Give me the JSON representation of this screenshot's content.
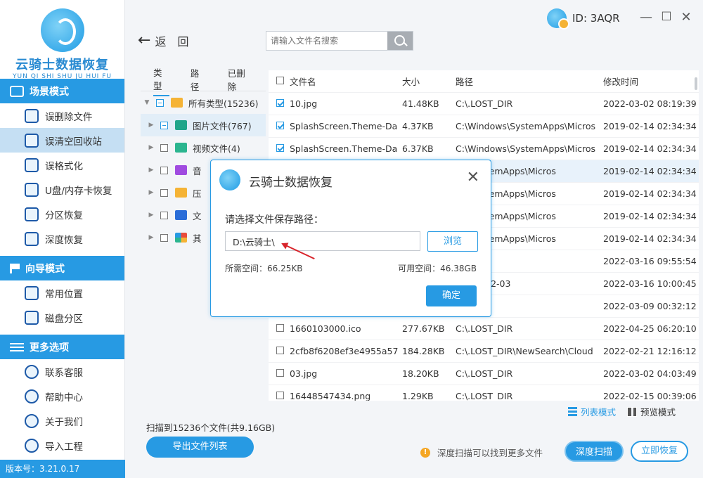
{
  "app": {
    "brand": "云骑士数据恢复",
    "brand_sub": "YUN QI SHI SHU JU HUI FU",
    "user_id": "ID: 3AQR",
    "version": "版本号：3.21.0.17"
  },
  "sidebar": {
    "sections": [
      {
        "title": "场景模式",
        "items": [
          "误删除文件",
          "误清空回收站",
          "误格式化",
          "U盘/内存卡恢复",
          "分区恢复",
          "深度恢复"
        ]
      },
      {
        "title": "向导模式",
        "items": [
          "常用位置",
          "磁盘分区"
        ]
      },
      {
        "title": "更多选项",
        "items": [
          "联系客服",
          "帮助中心",
          "关于我们",
          "导入工程"
        ]
      }
    ]
  },
  "toolbar": {
    "back_label": "返",
    "back_label_2": "回",
    "search_placeholder": "请输入文件名搜索"
  },
  "tree": {
    "tabs": [
      "类型",
      "路径",
      "已删除"
    ],
    "nodes": [
      {
        "label": "所有类型(15236)",
        "icon": "folder-icon"
      },
      {
        "label": "图片文件(767)",
        "icon": "image-icon"
      },
      {
        "label": "视频文件(4)",
        "icon": "video-icon"
      },
      {
        "label": "音",
        "icon": "music-icon"
      },
      {
        "label": "压",
        "icon": "archive-icon"
      },
      {
        "label": "文",
        "icon": "document-icon"
      },
      {
        "label": "其",
        "icon": "other-icon"
      }
    ]
  },
  "table": {
    "headers": [
      "文件名",
      "大小",
      "路径",
      "修改时间"
    ],
    "rows": [
      {
        "checked": true,
        "name": "10.jpg",
        "size": "41.48KB",
        "path": "C:\\.LOST_DIR",
        "time": "2022-03-02 08:19:39"
      },
      {
        "checked": true,
        "name": "SplashScreen.Theme-Da",
        "size": "4.37KB",
        "path": "C:\\Windows\\SystemApps\\Micros",
        "time": "2019-02-14 02:34:34"
      },
      {
        "checked": true,
        "name": "SplashScreen.Theme-Da",
        "size": "6.37KB",
        "path": "C:\\Windows\\SystemApps\\Micros",
        "time": "2019-02-14 02:34:34"
      },
      {
        "checked": false,
        "name": "",
        "size": "",
        "path": "ws\\SystemApps\\Micros",
        "time": "2019-02-14 02:34:34"
      },
      {
        "checked": false,
        "name": "",
        "size": "",
        "path": "ws\\SystemApps\\Micros",
        "time": "2019-02-14 02:34:34"
      },
      {
        "checked": false,
        "name": "",
        "size": "",
        "path": "ws\\SystemApps\\Micros",
        "time": "2019-02-14 02:34:34"
      },
      {
        "checked": false,
        "name": "",
        "size": "",
        "path": "ws\\SystemApps\\Micros",
        "time": "2019-02-14 02:34:34"
      },
      {
        "checked": false,
        "name": "",
        "size": "",
        "path": "DIR",
        "time": "2022-03-16 09:55:54"
      },
      {
        "checked": false,
        "name": "",
        "size": "",
        "path": "DIR\\2022-03",
        "time": "2022-03-16 10:00:45"
      },
      {
        "checked": false,
        "name": "",
        "size": "",
        "path": "DIR",
        "time": "2022-03-09 00:32:12"
      },
      {
        "checked": false,
        "name": "1660103000.ico",
        "size": "277.67KB",
        "path": "C:\\.LOST_DIR",
        "time": "2022-04-25 06:20:10"
      },
      {
        "checked": false,
        "name": "2cfb8f6208ef3e4955a57",
        "size": "184.28KB",
        "path": "C:\\.LOST_DIR\\NewSearch\\Cloud",
        "time": "2022-02-21 12:16:12"
      },
      {
        "checked": false,
        "name": "03.jpg",
        "size": "18.20KB",
        "path": "C:\\.LOST_DIR",
        "time": "2022-03-02 04:03:49"
      },
      {
        "checked": false,
        "name": "16448547434.png",
        "size": "1.29KB",
        "path": "C:\\.LOST_DIR",
        "time": "2022-02-15 00:39:06"
      }
    ]
  },
  "bottom": {
    "list_mode": "列表模式",
    "preview_mode": "预览模式",
    "scan_info": "扫描到15236个文件(共9.16GB)",
    "export_label": "导出文件列表",
    "hint": "深度扫描可以找到更多文件",
    "deep_scan_label": "深度扫描",
    "recover_label": "立即恢复"
  },
  "dialog": {
    "title": "云骑士数据恢复",
    "label": "请选择文件保存路径：",
    "path_value": "D:\\云骑士\\",
    "browse_label": "浏览",
    "need_space": "所需空间：66.25KB",
    "free_space": "可用空间：46.38GB",
    "ok_label": "确定"
  },
  "colors": {
    "accent": "#279ae3",
    "highlight_row": "#e8f2fb",
    "active_menu": "#c5dff3"
  }
}
